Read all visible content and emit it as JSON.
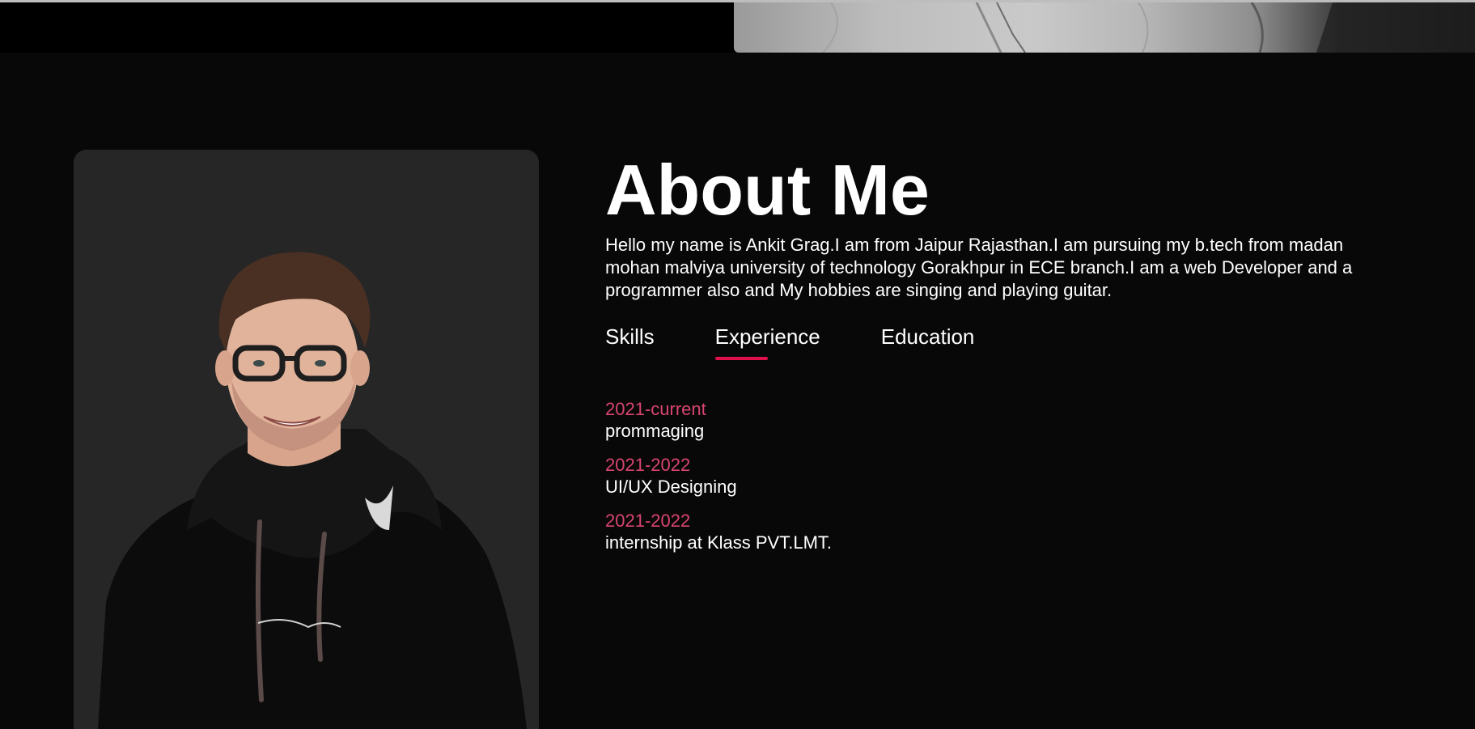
{
  "about": {
    "title": "About Me",
    "description": "Hello my name is Ankit Grag.I am from Jaipur Rajasthan.I am pursuing my b.tech from madan mohan malviya university of technology Gorakhpur in ECE branch.I am a web Developer and a programmer also and My hobbies are singing and playing guitar."
  },
  "tabs": [
    {
      "label": "Skills",
      "active": false
    },
    {
      "label": "Experience",
      "active": true
    },
    {
      "label": "Education",
      "active": false
    }
  ],
  "experience": [
    {
      "year": "2021-current",
      "role": "prommaging"
    },
    {
      "year": "2021-2022",
      "role": "UI/UX Designing"
    },
    {
      "year": "2021-2022",
      "role": "internship at Klass PVT.LMT."
    }
  ],
  "colors": {
    "background": "#080808",
    "card": "#262626",
    "accent": "#e0104d",
    "year_text": "#d8456f"
  },
  "images": {
    "hero_photo": "person-shirt-photo",
    "profile_photo": "person-hoodie-glasses-photo"
  }
}
